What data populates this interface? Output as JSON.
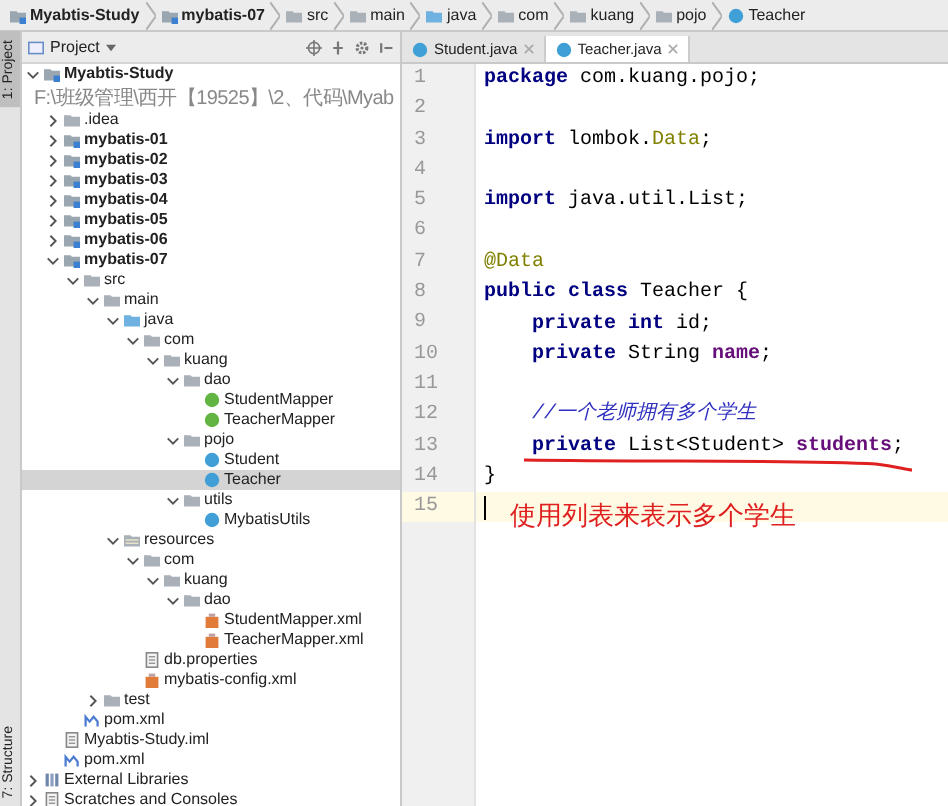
{
  "breadcrumb": [
    {
      "label": "Myabtis-Study",
      "kind": "module"
    },
    {
      "label": "mybatis-07",
      "kind": "module"
    },
    {
      "label": "src",
      "kind": "folder"
    },
    {
      "label": "main",
      "kind": "folder"
    },
    {
      "label": "java",
      "kind": "source"
    },
    {
      "label": "com",
      "kind": "package"
    },
    {
      "label": "kuang",
      "kind": "package"
    },
    {
      "label": "pojo",
      "kind": "package"
    },
    {
      "label": "Teacher",
      "kind": "class"
    }
  ],
  "side_tabs": [
    {
      "label": "1: Project",
      "selected": true
    },
    {
      "label": "7: Structure",
      "selected": false
    }
  ],
  "project_panel": {
    "title": "Project"
  },
  "tree": [
    {
      "name": "Myabtis-Study",
      "kind": "module",
      "path": "F:\\班级管理\\西开【19525】\\2、代码\\Myab",
      "expanded": true,
      "selected": false,
      "children": [
        {
          "name": ".idea",
          "kind": "folder",
          "expanded": false,
          "selected": false
        },
        {
          "name": "mybatis-01",
          "kind": "module",
          "expanded": false,
          "selected": false
        },
        {
          "name": "mybatis-02",
          "kind": "module",
          "expanded": false,
          "selected": false
        },
        {
          "name": "mybatis-03",
          "kind": "module",
          "expanded": false,
          "selected": false
        },
        {
          "name": "mybatis-04",
          "kind": "module",
          "expanded": false,
          "selected": false
        },
        {
          "name": "mybatis-05",
          "kind": "module",
          "expanded": false,
          "selected": false
        },
        {
          "name": "mybatis-06",
          "kind": "module",
          "expanded": false,
          "selected": false
        },
        {
          "name": "mybatis-07",
          "kind": "module",
          "expanded": true,
          "selected": false,
          "children": [
            {
              "name": "src",
              "kind": "folder",
              "expanded": true,
              "selected": false,
              "children": [
                {
                  "name": "main",
                  "kind": "folder",
                  "expanded": true,
                  "selected": false,
                  "children": [
                    {
                      "name": "java",
                      "kind": "source",
                      "expanded": true,
                      "selected": false,
                      "children": [
                        {
                          "name": "com",
                          "kind": "package",
                          "expanded": true,
                          "selected": false,
                          "children": [
                            {
                              "name": "kuang",
                              "kind": "package",
                              "expanded": true,
                              "selected": false,
                              "children": [
                                {
                                  "name": "dao",
                                  "kind": "package",
                                  "expanded": true,
                                  "selected": false,
                                  "children": [
                                    {
                                      "name": "StudentMapper",
                                      "kind": "interface",
                                      "selected": false
                                    },
                                    {
                                      "name": "TeacherMapper",
                                      "kind": "interface",
                                      "selected": false
                                    }
                                  ]
                                },
                                {
                                  "name": "pojo",
                                  "kind": "package",
                                  "expanded": true,
                                  "selected": false,
                                  "children": [
                                    {
                                      "name": "Student",
                                      "kind": "class",
                                      "selected": false
                                    },
                                    {
                                      "name": "Teacher",
                                      "kind": "class",
                                      "selected": true
                                    }
                                  ]
                                },
                                {
                                  "name": "utils",
                                  "kind": "package",
                                  "expanded": true,
                                  "selected": false,
                                  "children": [
                                    {
                                      "name": "MybatisUtils",
                                      "kind": "class",
                                      "selected": false
                                    }
                                  ]
                                }
                              ]
                            }
                          ]
                        }
                      ]
                    },
                    {
                      "name": "resources",
                      "kind": "resources",
                      "expanded": true,
                      "selected": false,
                      "children": [
                        {
                          "name": "com",
                          "kind": "package",
                          "expanded": true,
                          "selected": false,
                          "children": [
                            {
                              "name": "kuang",
                              "kind": "package",
                              "expanded": true,
                              "selected": false,
                              "children": [
                                {
                                  "name": "dao",
                                  "kind": "package",
                                  "expanded": true,
                                  "selected": false,
                                  "children": [
                                    {
                                      "name": "StudentMapper.xml",
                                      "kind": "xml",
                                      "selected": false
                                    },
                                    {
                                      "name": "TeacherMapper.xml",
                                      "kind": "xml",
                                      "selected": false
                                    }
                                  ]
                                }
                              ]
                            }
                          ]
                        },
                        {
                          "name": "db.properties",
                          "kind": "properties",
                          "selected": false
                        },
                        {
                          "name": "mybatis-config.xml",
                          "kind": "xml",
                          "selected": false
                        }
                      ]
                    }
                  ]
                },
                {
                  "name": "test",
                  "kind": "folder",
                  "expanded": false,
                  "selected": false
                }
              ]
            },
            {
              "name": "pom.xml",
              "kind": "maven",
              "selected": false
            }
          ]
        },
        {
          "name": "Myabtis-Study.iml",
          "kind": "iml",
          "selected": false
        },
        {
          "name": "pom.xml",
          "kind": "maven",
          "selected": false
        }
      ]
    },
    {
      "name": "External Libraries",
      "kind": "libraries",
      "expanded": false,
      "selected": false
    },
    {
      "name": "Scratches and Consoles",
      "kind": "scratches",
      "expanded": false,
      "selected": false
    }
  ],
  "editor": {
    "tabs": [
      {
        "label": "Student.java",
        "selected": false
      },
      {
        "label": "Teacher.java",
        "selected": true
      }
    ],
    "lines": [
      {
        "number": "1",
        "current": false,
        "tokens": [
          {
            "text": "package",
            "kind": "kw"
          },
          {
            "text": " com.kuang.pojo;",
            "kind": "plain"
          }
        ]
      },
      {
        "number": "2",
        "current": false
      },
      {
        "number": "3",
        "current": false,
        "tokens": [
          {
            "text": "import",
            "kind": "kw"
          },
          {
            "text": " lombok.",
            "kind": "plain"
          },
          {
            "text": "Data",
            "kind": "ann"
          },
          {
            "text": ";",
            "kind": "plain"
          }
        ]
      },
      {
        "number": "4",
        "current": false
      },
      {
        "number": "5",
        "current": false,
        "tokens": [
          {
            "text": "import",
            "kind": "kw"
          },
          {
            "text": " java.util.List;",
            "kind": "plain"
          }
        ]
      },
      {
        "number": "6",
        "current": false
      },
      {
        "number": "7",
        "current": false,
        "tokens": [
          {
            "text": "@Data",
            "kind": "ann"
          }
        ]
      },
      {
        "number": "8",
        "current": false,
        "tokens": [
          {
            "text": "public class",
            "kind": "kw"
          },
          {
            "text": " Teacher {",
            "kind": "plain"
          }
        ]
      },
      {
        "number": "9",
        "current": false,
        "tokens": [
          {
            "text": "    private int",
            "kind": "kw"
          },
          {
            "text": " id;",
            "kind": "plain"
          }
        ]
      },
      {
        "number": "10",
        "current": false,
        "tokens": [
          {
            "text": "    private",
            "kind": "kw"
          },
          {
            "text": " String ",
            "kind": "plain"
          },
          {
            "text": "name",
            "kind": "field"
          },
          {
            "text": ";",
            "kind": "plain"
          }
        ]
      },
      {
        "number": "11",
        "current": false
      },
      {
        "number": "12",
        "current": false,
        "tokens": [
          {
            "text": "    //一个老师拥有多个学生",
            "kind": "comment"
          }
        ]
      },
      {
        "number": "13",
        "current": false,
        "tokens": [
          {
            "text": "    private",
            "kind": "kw"
          },
          {
            "text": " List<Student> ",
            "kind": "plain"
          },
          {
            "text": "students",
            "kind": "field"
          },
          {
            "text": ";",
            "kind": "plain"
          }
        ]
      },
      {
        "number": "14",
        "current": false,
        "tokens": [
          {
            "text": "}",
            "kind": "plain"
          }
        ]
      },
      {
        "number": "15",
        "current": true
      }
    ],
    "note": "使用列表来表示多个学生"
  }
}
